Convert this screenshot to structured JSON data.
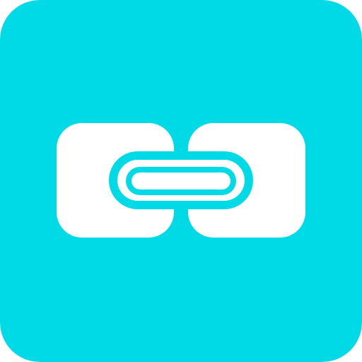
{
  "icon": {
    "name": "link-icon",
    "background_color": "#00DAE6",
    "foreground_color": "#FFFFFF"
  }
}
